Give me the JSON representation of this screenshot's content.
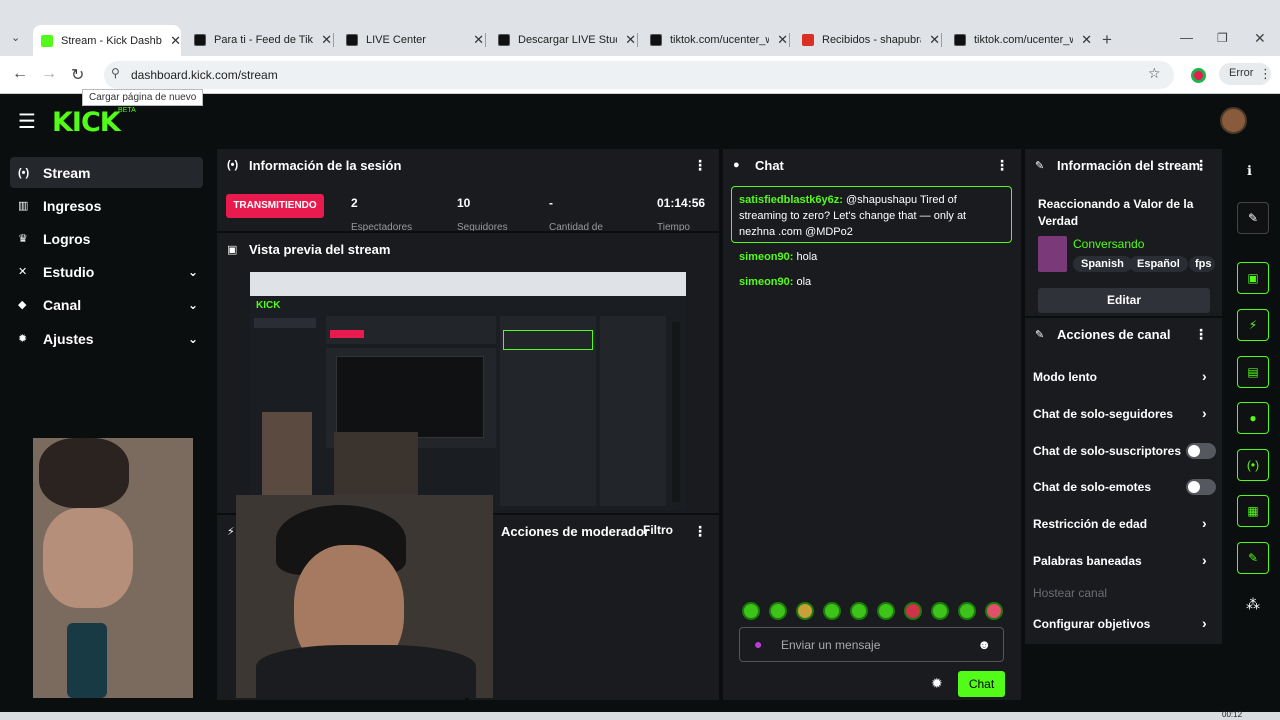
{
  "browser": {
    "tabs": [
      {
        "label": "Stream - Kick Dashboard",
        "color": "#53fc18"
      },
      {
        "label": "Para ti - Feed de TikTok",
        "color": "#111111"
      },
      {
        "label": "LIVE Center",
        "color": "#111111"
      },
      {
        "label": "Descargar LIVE Studio",
        "color": "#111111"
      },
      {
        "label": "tiktok.com/ucenter_web",
        "color": "#111111"
      },
      {
        "label": "Recibidos - shapubra",
        "color": "#d93025"
      },
      {
        "label": "tiktok.com/ucenter_web",
        "color": "#111111"
      }
    ],
    "url": "dashboard.kick.com/stream",
    "tooltip": "Cargar página de nuevo",
    "error_label": "Error"
  },
  "app": {
    "logo": "KICK",
    "beta": "BETA",
    "accent": "#53fc18"
  },
  "sidebar": {
    "items": [
      {
        "label": "Stream",
        "icon": "stream-icon"
      },
      {
        "label": "Ingresos",
        "icon": "chart-icon"
      },
      {
        "label": "Logros",
        "icon": "trophy-icon"
      },
      {
        "label": "Estudio",
        "icon": "studio-icon"
      },
      {
        "label": "Canal",
        "icon": "channel-icon"
      },
      {
        "label": "Ajustes",
        "icon": "gear-icon"
      }
    ]
  },
  "session": {
    "title": "Información de la sesión",
    "status": "TRANSMITIENDO",
    "stats": [
      {
        "value": "2",
        "label": "Espectadores"
      },
      {
        "value": "10",
        "label": "Seguidores"
      },
      {
        "value": "-",
        "label": "Cantidad de"
      },
      {
        "value": "01:14:56",
        "label": "Tiempo"
      }
    ]
  },
  "preview": {
    "title": "Vista previa del stream"
  },
  "panels": {
    "filter_label": "Filtro",
    "moderator_title": "Acciones de moderador",
    "activity_prefix": "F"
  },
  "chat": {
    "title": "Chat",
    "highlighted": {
      "user": "satisfiedblastk6y6z:",
      "text": "@shapushapu Tired of streaming to zero? Let's change that — only at nezhna .com @MDPo2"
    },
    "messages": [
      {
        "user": "simeon90:",
        "text": "hola"
      },
      {
        "user": "simeon90:",
        "text": "ola"
      }
    ],
    "input_placeholder": "Enviar un mensaje",
    "send_label": "Chat"
  },
  "stream_info": {
    "title": "Información del stream",
    "stream_title": "Reaccionando a Valor de la Verdad",
    "category": "Conversando",
    "tags": [
      "Spanish",
      "Español",
      "fps"
    ],
    "edit_label": "Editar"
  },
  "channel_actions": {
    "title": "Acciones de canal",
    "items": [
      {
        "label": "Modo lento",
        "control": "arrow"
      },
      {
        "label": "Chat de solo-seguidores",
        "control": "arrow"
      },
      {
        "label": "Chat de solo-suscriptores",
        "control": "toggle",
        "on": false
      },
      {
        "label": "Chat de solo-emotes",
        "control": "toggle",
        "on": false
      },
      {
        "label": "Restricción de edad",
        "control": "arrow"
      },
      {
        "label": "Palabras baneadas",
        "control": "arrow"
      },
      {
        "label": "Hostear canal",
        "control": "none",
        "disabled": true
      },
      {
        "label": "Configurar objetivos",
        "control": "arrow"
      }
    ]
  },
  "status_time": "00:12"
}
